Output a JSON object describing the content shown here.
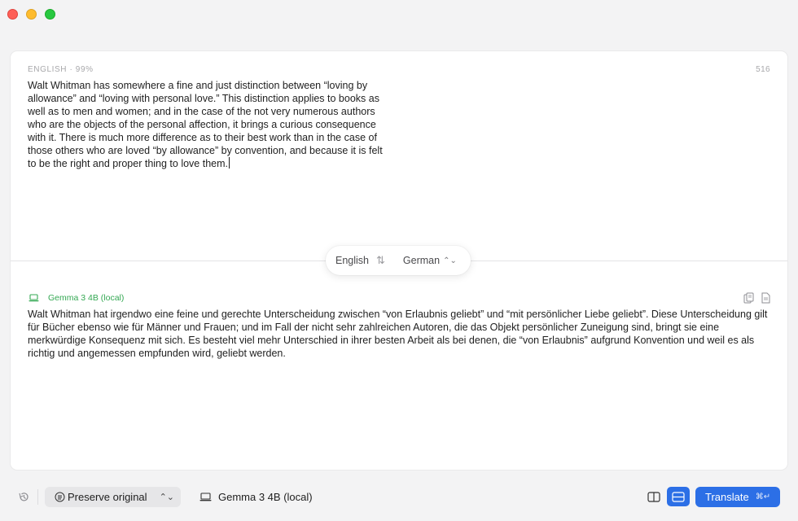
{
  "window": {
    "controls": [
      "close",
      "minimize",
      "zoom"
    ]
  },
  "source": {
    "header": "ENGLISH · 99%",
    "char_count": "516",
    "text": "Walt Whitman has somewhere a fine and just distinction between “loving by allowance” and “loving with personal love.” This distinction applies to books as well as to men and women; and in the case of the not very numerous authors who are the objects of the personal affection, it brings a curious consequence with it. There is much more difference as to their best work than in the case of those others who are loved “by allowance” by convention, and because it is felt to be the right and proper thing to love them."
  },
  "languages": {
    "source": "English",
    "target": "German",
    "swap_icon": "swap-arrows-icon",
    "target_icon": "chevron-updown-icon"
  },
  "output": {
    "model_label": "Gemma 3 4B (local)",
    "model_icon": "laptop-icon",
    "tools": [
      "copy-icon",
      "document-icon"
    ],
    "text": "Walt Whitman hat irgendwo eine feine und gerechte Unterscheidung zwischen “von Erlaubnis geliebt” und “mit persönlicher Liebe geliebt”. Diese Unterscheidung gilt für Bücher ebenso wie für Männer und Frauen; und im Fall der nicht sehr zahlreichen Autoren, die das Objekt persönlicher Zuneigung sind, bringt sie eine merkwürdige Konsequenz mit sich. Es besteht viel mehr Unterschied in ihrer besten Arbeit als bei denen, die “von Erlaubnis” aufgrund Konvention und weil es als richtig und angemessen empfunden wird, geliebt werden."
  },
  "bottombar": {
    "history_icon": "history-icon",
    "preserve_label": "Preserve original",
    "model_label": "Gemma 3 4B (local)",
    "translate_label": "Translate",
    "translate_shortcut": "⌘↵",
    "layout_options": [
      "side-by-side",
      "stacked"
    ],
    "layout_selected": "stacked"
  },
  "colors": {
    "accent": "#2c6fe6",
    "model_green": "#34a853",
    "close": "#fe5f57",
    "minimize": "#febc2e",
    "zoom": "#28c840"
  }
}
